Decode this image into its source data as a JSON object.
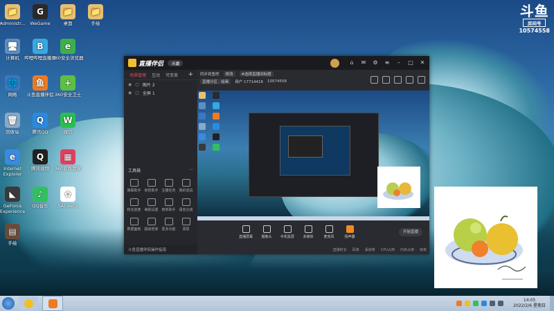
{
  "desktop": {
    "icons": [
      {
        "label": "Administr...",
        "glyph": "📁",
        "bg": "#e8c070"
      },
      {
        "label": "WeGame",
        "glyph": "G",
        "bg": "#2a2a2a"
      },
      {
        "label": "桌面",
        "glyph": "📁",
        "bg": "#e8c070"
      },
      {
        "label": "手绘",
        "glyph": "📁",
        "bg": "#e8c070"
      },
      {
        "label": "计算机",
        "glyph": "🖥",
        "bg": "#5f8fc0"
      },
      {
        "label": "哔哩哔哩直播姬",
        "glyph": "B",
        "bg": "#38a8e0"
      },
      {
        "label": "360安全浏览器",
        "glyph": "e",
        "bg": "#3cb04a"
      },
      {
        "label": "网络",
        "glyph": "🌐",
        "bg": "#3a78c0"
      },
      {
        "label": "斗鱼直播伴侣",
        "glyph": "鱼",
        "bg": "#f07a20"
      },
      {
        "label": "360安全卫士",
        "glyph": "+",
        "bg": "#5cc040"
      },
      {
        "label": "回收站",
        "glyph": "🗑",
        "bg": "#8aa8c8"
      },
      {
        "label": "腾讯QQ",
        "glyph": "Q",
        "bg": "#2a8ae0"
      },
      {
        "label": "微信",
        "glyph": "W",
        "bg": "#2ac050"
      },
      {
        "label": "Internet Explorer",
        "glyph": "e",
        "bg": "#3a8ae0"
      },
      {
        "label": "腾讯视频",
        "glyph": "Q",
        "bg": "#222"
      },
      {
        "label": "360软件管家",
        "glyph": "▦",
        "bg": "#e04060"
      },
      {
        "label": "GeForce Experience",
        "glyph": "◣",
        "bg": "#3a3a3a"
      },
      {
        "label": "QQ音乐",
        "glyph": "♪",
        "bg": "#30c060"
      },
      {
        "label": "SAI Ver.2",
        "glyph": "✿",
        "bg": "#ffffff"
      },
      {
        "label": "手绘",
        "glyph": "▤",
        "bg": "#6a4a3a"
      }
    ]
  },
  "room_badge": {
    "logo": "斗鱼",
    "label": "房间号",
    "number": "10574558"
  },
  "app": {
    "title": "直播伴侣",
    "version": "斗鱼",
    "sidebar": {
      "tabs": [
        "场景管理",
        "互动",
        "可变美"
      ],
      "scenes": [
        "图片 2",
        "全屏 1"
      ],
      "tool_header": "工具箱",
      "tools": [
        "弹幕助手",
        "房管助手",
        "主播任务",
        "我的道具",
        "粉丝连麦",
        "美颜设置",
        "榜单助手",
        "语音合成",
        "数据面板",
        "超级管家",
        "更多功能",
        "录屏"
      ],
      "footer": "斗鱼直播伴侣操作指南"
    },
    "infobar": {
      "items": [
        "同步到鱼吧",
        "修改",
        "#选择直播间标题",
        "直播分区 · 绘画",
        "用户 17714416",
        "10574558"
      ]
    },
    "controls": [
      "直播屏幕",
      "摄像头",
      "手机投屏",
      "多媒体",
      "麦克风",
      "扬声器"
    ],
    "go_live": "开始直播",
    "statusbar": [
      "直播时长",
      "码率",
      "丢帧率",
      "CPU占用",
      "内存占用",
      "帧率"
    ]
  },
  "taskbar": {
    "time": "14:05",
    "date": "2022/2/6 星期日"
  }
}
